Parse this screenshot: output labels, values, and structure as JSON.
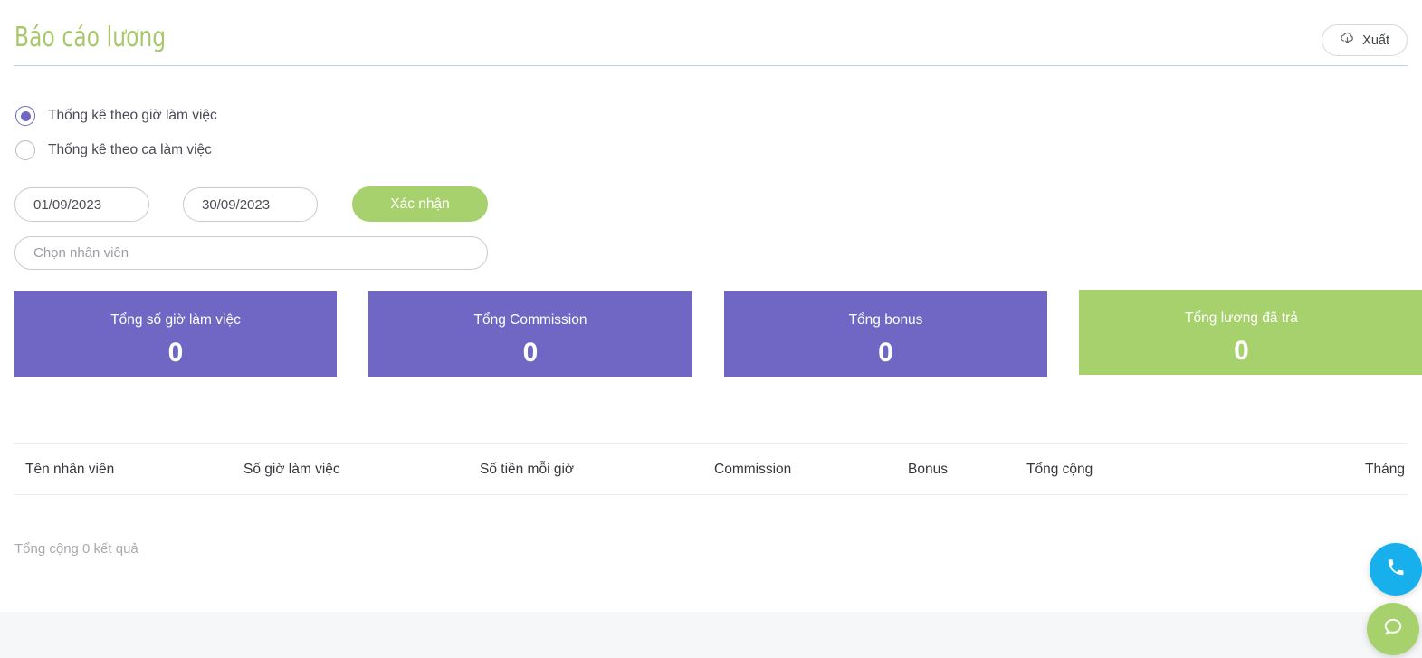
{
  "header": {
    "title": "Báo cáo lương",
    "export_label": "Xuất",
    "export_icon": "cloud-download-icon"
  },
  "filters": {
    "radios": [
      {
        "label": "Thống kê theo giờ làm việc",
        "checked": true
      },
      {
        "label": "Thống kê theo ca làm việc",
        "checked": false
      }
    ],
    "date_from": "01/09/2023",
    "date_to": "30/09/2023",
    "confirm_label": "Xác nhận",
    "employee_placeholder": "Chọn nhân viên"
  },
  "stats": [
    {
      "title": "Tổng số giờ làm việc",
      "value": "0",
      "color": "#6f67c3"
    },
    {
      "title": "Tổng Commission",
      "value": "0",
      "color": "#6f67c3"
    },
    {
      "title": "Tổng bonus",
      "value": "0",
      "color": "#6f67c3"
    },
    {
      "title": "Tổng lương đã trả",
      "value": "0",
      "color": "#a7d16d"
    }
  ],
  "table": {
    "columns": [
      "Tên nhân viên",
      "Số giờ làm việc",
      "Số tiền mỗi giờ",
      "Commission",
      "Bonus",
      "Tổng cộng",
      "Tháng"
    ],
    "rows": [],
    "result_count_text": "Tổng cộng 0 kết quả"
  },
  "floating": {
    "call_icon": "phone-icon",
    "chat_icon": "chat-bubble-icon"
  },
  "colors": {
    "accent_green": "#a7d16d",
    "accent_purple": "#6f67c3",
    "title_green": "#a8c76a",
    "divider_blue": "#b9d5dd",
    "call_blue": "#18b0ec"
  }
}
